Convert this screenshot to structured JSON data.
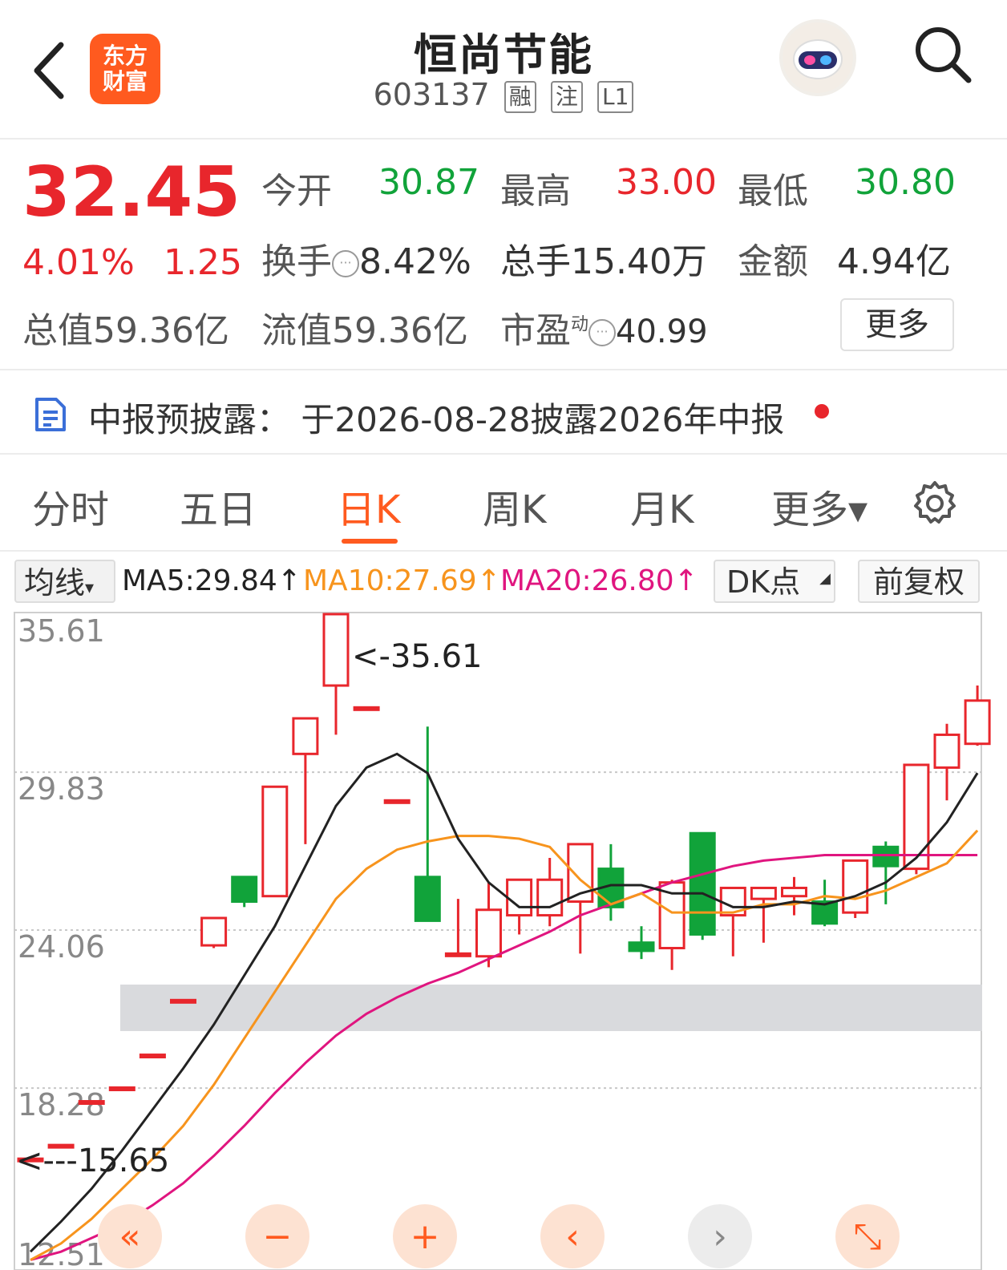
{
  "header": {
    "title": "恒尚节能",
    "code": "603137",
    "tags": [
      "融",
      "注",
      "L1"
    ],
    "logo_line1": "东方",
    "logo_line2": "财富"
  },
  "quote": {
    "price": "32.45",
    "change_pct": "4.01%",
    "change_amt": "1.25",
    "open_label": "今开",
    "open_value": "30.87",
    "high_label": "最高",
    "high_value": "33.00",
    "low_label": "最低",
    "low_value": "30.80",
    "turnover_label": "换手",
    "turnover_value": "8.42%",
    "volume_text": "总手15.40万",
    "amount_label": "金额",
    "amount_value": "4.94亿",
    "total_value_text": "总值59.36亿",
    "float_value_text": "流值59.36亿",
    "pe_label": "市盈",
    "pe_sup": "动",
    "pe_value": "40.99",
    "more_label": "更多"
  },
  "notice": {
    "text": "中报预披露：  于2026-08-28披露2026年中报"
  },
  "tabs": [
    "分时",
    "五日",
    "日K",
    "周K",
    "月K",
    "更多▾"
  ],
  "ma_bar": {
    "select_label": "均线",
    "ma5": "MA5:29.84↑",
    "ma10": "MA10:27.69↑",
    "ma20": "MA20:26.80↑",
    "dk_label": "DK点",
    "adjust_label": "前复权"
  },
  "colors": {
    "up": "#e8262c",
    "down": "#11a33a",
    "accent": "#ff5a1f",
    "ma5": "#222222",
    "ma10": "#f7941d",
    "ma20": "#e0157f"
  },
  "chart_data": {
    "type": "candlestick",
    "y_ticks": [
      "35.61",
      "29.83",
      "24.06",
      "18.28",
      "12.51"
    ],
    "ylim": [
      12.51,
      35.61
    ],
    "max_label": "<-35.61",
    "min_label": "<---15.65",
    "candles": [
      {
        "o": 15.7,
        "c": 15.7,
        "h": 15.7,
        "l": 15.7
      },
      {
        "o": 16.2,
        "c": 16.2,
        "h": 16.2,
        "l": 16.2
      },
      {
        "o": 17.8,
        "c": 17.8,
        "h": 17.8,
        "l": 17.8
      },
      {
        "o": 18.3,
        "c": 18.3,
        "h": 18.3,
        "l": 18.3
      },
      {
        "o": 19.5,
        "c": 19.5,
        "h": 19.5,
        "l": 19.5
      },
      {
        "o": 21.5,
        "c": 21.5,
        "h": 21.5,
        "l": 21.5
      },
      {
        "o": 23.5,
        "c": 24.5,
        "h": 24.5,
        "l": 23.4
      },
      {
        "o": 26.0,
        "c": 25.1,
        "h": 26.0,
        "l": 24.9
      },
      {
        "o": 25.3,
        "c": 29.3,
        "h": 29.3,
        "l": 25.3
      },
      {
        "o": 30.5,
        "c": 31.8,
        "h": 31.8,
        "l": 27.2
      },
      {
        "o": 33.0,
        "c": 35.61,
        "h": 35.61,
        "l": 31.2
      },
      {
        "o": 32.2,
        "c": 32.2,
        "h": 32.2,
        "l": 32.2
      },
      {
        "o": 28.8,
        "c": 28.8,
        "h": 28.8,
        "l": 28.8
      },
      {
        "o": 26.0,
        "c": 24.4,
        "h": 31.5,
        "l": 24.4
      },
      {
        "o": 23.2,
        "c": 23.2,
        "h": 25.2,
        "l": 23.1
      },
      {
        "o": 23.1,
        "c": 24.8,
        "h": 25.8,
        "l": 22.7
      },
      {
        "o": 24.6,
        "c": 25.9,
        "h": 25.9,
        "l": 23.9
      },
      {
        "o": 24.6,
        "c": 25.9,
        "h": 26.7,
        "l": 24.2
      },
      {
        "o": 25.1,
        "c": 27.2,
        "h": 27.2,
        "l": 23.2
      },
      {
        "o": 26.3,
        "c": 24.9,
        "h": 27.2,
        "l": 24.4
      },
      {
        "o": 23.6,
        "c": 23.3,
        "h": 24.2,
        "l": 23.0
      },
      {
        "o": 23.4,
        "c": 25.8,
        "h": 25.9,
        "l": 22.6
      },
      {
        "o": 27.6,
        "c": 23.9,
        "h": 27.6,
        "l": 23.7
      },
      {
        "o": 24.6,
        "c": 25.6,
        "h": 25.6,
        "l": 23.1
      },
      {
        "o": 25.2,
        "c": 25.6,
        "h": 25.6,
        "l": 23.6
      },
      {
        "o": 25.3,
        "c": 25.6,
        "h": 26.0,
        "l": 24.6
      },
      {
        "o": 25.1,
        "c": 24.3,
        "h": 25.9,
        "l": 24.2
      },
      {
        "o": 24.7,
        "c": 26.6,
        "h": 26.6,
        "l": 24.5
      },
      {
        "o": 27.1,
        "c": 26.4,
        "h": 27.3,
        "l": 25.0
      },
      {
        "o": 26.3,
        "c": 30.1,
        "h": 30.1,
        "l": 26.1
      },
      {
        "o": 30.0,
        "c": 31.2,
        "h": 31.6,
        "l": 28.8
      },
      {
        "o": 30.87,
        "c": 32.45,
        "h": 33.0,
        "l": 30.8
      }
    ],
    "ma5": [
      12.3,
      13.4,
      14.6,
      16.0,
      17.5,
      19.0,
      20.6,
      22.4,
      24.2,
      26.4,
      28.6,
      30.0,
      30.5,
      29.8,
      27.4,
      25.8,
      24.9,
      24.9,
      25.4,
      25.7,
      25.7,
      25.4,
      25.4,
      24.9,
      24.9,
      25.1,
      25.0,
      25.3,
      25.8,
      26.7,
      28.0,
      29.8
    ],
    "ma10": [
      12.0,
      12.6,
      13.5,
      14.6,
      15.7,
      16.9,
      18.4,
      20.1,
      21.8,
      23.5,
      25.2,
      26.3,
      27.0,
      27.3,
      27.5,
      27.5,
      27.4,
      27.1,
      25.9,
      25.0,
      25.4,
      24.7,
      24.7,
      24.7,
      25.0,
      25.0,
      25.3,
      25.2,
      25.5,
      26.0,
      26.5,
      27.7
    ],
    "ma20": [
      12.0,
      12.3,
      12.8,
      13.3,
      14.0,
      14.8,
      15.8,
      16.9,
      18.1,
      19.2,
      20.2,
      21.0,
      21.6,
      22.1,
      22.5,
      23.0,
      23.5,
      24.0,
      24.6,
      25.0,
      25.4,
      25.8,
      26.1,
      26.4,
      26.6,
      26.7,
      26.8,
      26.8,
      26.8,
      26.8,
      26.8,
      26.8
    ]
  },
  "controls": [
    "«",
    "−",
    "+",
    "‹",
    "›",
    "⤡"
  ]
}
